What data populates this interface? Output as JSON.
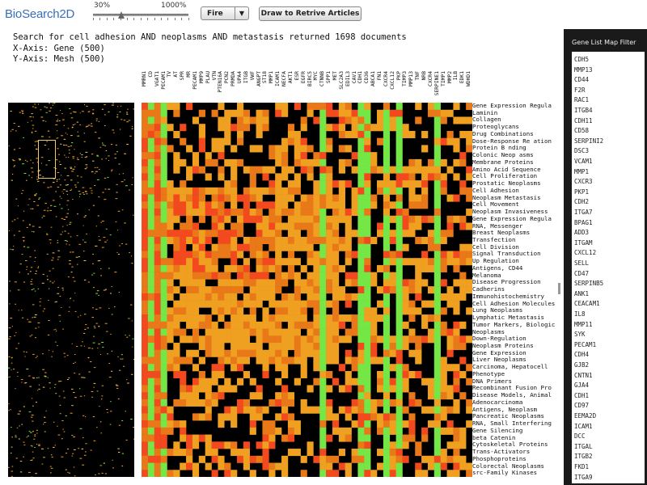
{
  "app": {
    "title": "BioSearch2D"
  },
  "zoom": {
    "min_label": "30%",
    "max_label": "1000%",
    "value_fraction": 0.3
  },
  "palette": {
    "selected": "Fire",
    "arrow": "▼"
  },
  "buttons": {
    "draw": "Draw to Retrive Articles"
  },
  "info": {
    "query": "Search for cell adhesion AND neoplasms AND metastasis returned 1698 documents",
    "x_axis": "X-Axis: Gene (500)",
    "y_axis": "Y-Axis: Mesh (500)"
  },
  "columns": [
    "MMRN1",
    "CD",
    "VGAT1",
    "PECAM1",
    "TV",
    "AT",
    "SPR",
    "MR",
    "PECAM1",
    "MMP9",
    "PLAU",
    "VTN",
    "PTEN16A",
    "PCN2",
    "PRMDA",
    "UPA4",
    "ITGB",
    "VWF",
    "ANGPT",
    "ST18",
    "MMP1",
    "ICAM1",
    "NECFA",
    "AKT1",
    "ESR",
    "EGFR",
    "BIRC5",
    "MYC",
    "CTNNB",
    "SPP1",
    "MET",
    "SLC2A3",
    "EDIL3",
    "CAV1",
    "CDH1",
    "CD36",
    "ABCA1",
    "FN1",
    "CXCR4",
    "CXCL12",
    "PKP",
    "TIMP3",
    "MMP13",
    "TNF",
    "NRB",
    "CXCR4",
    "SERPINE1",
    "TIMP1",
    "MMP2",
    "ILB",
    "EDK1",
    "WDHD1"
  ],
  "rows": [
    "Gene Expression Regula",
    "Laminin",
    "Collagen",
    "Proteoglycans",
    "Drug Combinations",
    "Dose-Response Re ation",
    "Protein B nding",
    "Colonic Neop asms",
    "Membrane Proteins",
    "Amino Acid Sequence",
    "Cell Proliferation",
    "Prostatic Neoplasms",
    "Cell Adhesion",
    "Neoplasm Metastasis",
    "Cell Movement",
    "Neoplasm Invasiveness",
    "Gene Expression Regula",
    "RNA, Messenger",
    "Breast Neoplasms",
    "Transfection",
    "Cell Division",
    "Signal Transduction",
    "Up Regulation",
    "Antigens, CD44",
    "Melanoma",
    "Disease Progression",
    "Cadherins",
    "Immunohistochemistry",
    "Cell Adhesion Molecules",
    "Lung Neoplasms",
    "Lymphatic Metastasis",
    "Tumor Markers, Biologic",
    "Neoplasms",
    "Down-Regulation",
    "Neoplasm Proteins",
    "Gene Expression",
    "Liver Neoplasms",
    "Carcinoma, Hepatocell",
    "Phenotype",
    "DNA Primers",
    "Recombinant Fusion Pro",
    "Disease Models, Animal",
    "Adenocarcinoma",
    "Antigens, Neoplasm",
    "Pancreatic Neoplasms",
    "RNA, Small Interfering",
    "Gene Silencing",
    "beta Catenin",
    "Cytoskeletal Proteins",
    "Trans-Activators",
    "Phosphoproteins",
    "Colorectal Neoplasms",
    "src-Family Kinases"
  ],
  "gene_panel": {
    "title": "Gene List Map Filter",
    "genes": [
      "CDH5",
      "MMP13",
      "CD44",
      "F2R",
      "RAC1",
      "ITGB4",
      "CDH11",
      "CD58",
      "SERPINI2",
      "DSC3",
      "VCAM1",
      "MMP1",
      "CXCR3",
      "PKP1",
      "CDH2",
      "ITGA7",
      "BPAG1",
      "ADD3",
      "ITGAM",
      "CXCL12",
      "SELL",
      "CD47",
      "SERPINB5",
      "ANK1",
      "CEACAM1",
      "IL8",
      "MMP11",
      "SYK",
      "PECAM1",
      "CDH4",
      "GJB2",
      "CNTN1",
      "GJA4",
      "CDH1",
      "CD97",
      "EEMA2D",
      "ICAM1",
      "DCC",
      "ITGAL",
      "ITGB2",
      "FKD1",
      "ITGA9"
    ]
  },
  "colors": {
    "brand": "#3a6fb8",
    "heat_black": "#000000",
    "heat_orange": "#f0a020",
    "heat_darkorange": "#e87818",
    "heat_red": "#f24a1e",
    "heat_green": "#74e645"
  }
}
